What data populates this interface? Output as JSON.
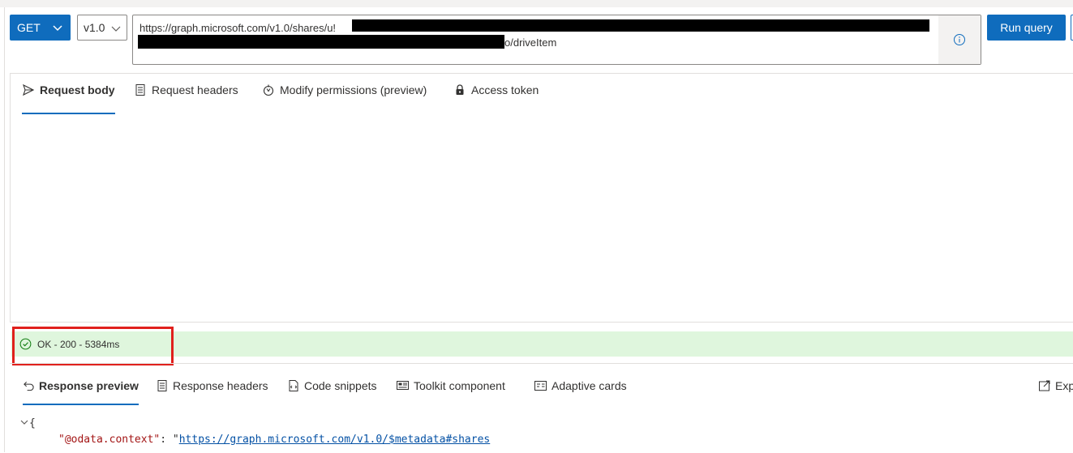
{
  "query": {
    "method": "GET",
    "version": "v1.0",
    "url_line1": "https://graph.microsoft.com/v1.0/shares/u!",
    "url_line2_suffix": "o/driveItem",
    "info_icon": "info-icon",
    "run_label": "Run query"
  },
  "request_tabs": [
    {
      "label": "Request body",
      "icon": "send-icon",
      "active": true
    },
    {
      "label": "Request headers",
      "icon": "document-icon",
      "active": false
    },
    {
      "label": "Modify permissions (preview)",
      "icon": "shield-icon",
      "active": false
    },
    {
      "label": "Access token",
      "icon": "lock-icon",
      "active": false
    }
  ],
  "status": {
    "text": "OK - 200 - 5384ms",
    "icon": "check-circle-icon",
    "color": "#dff6dd"
  },
  "response_tabs": [
    {
      "label": "Response preview",
      "icon": "undo-arrow-icon",
      "active": true
    },
    {
      "label": "Response headers",
      "icon": "document-icon",
      "active": false
    },
    {
      "label": "Code snippets",
      "icon": "code-page-icon",
      "active": false
    },
    {
      "label": "Toolkit component",
      "icon": "toolkit-icon",
      "active": false
    },
    {
      "label": "Adaptive cards",
      "icon": "card-icon",
      "active": false
    },
    {
      "label": "Exp",
      "icon": "export-icon",
      "active": false
    }
  ],
  "response_json": {
    "open_brace": "{",
    "key": "\"@odata.context\"",
    "colon": ": \"",
    "value": "https://graph.microsoft.com/v1.0/$metadata#shares"
  },
  "colors": {
    "accent": "#0f6cbd",
    "highlight_border": "#e0201c",
    "json_key": "#a31515",
    "json_link": "#0451a5"
  }
}
